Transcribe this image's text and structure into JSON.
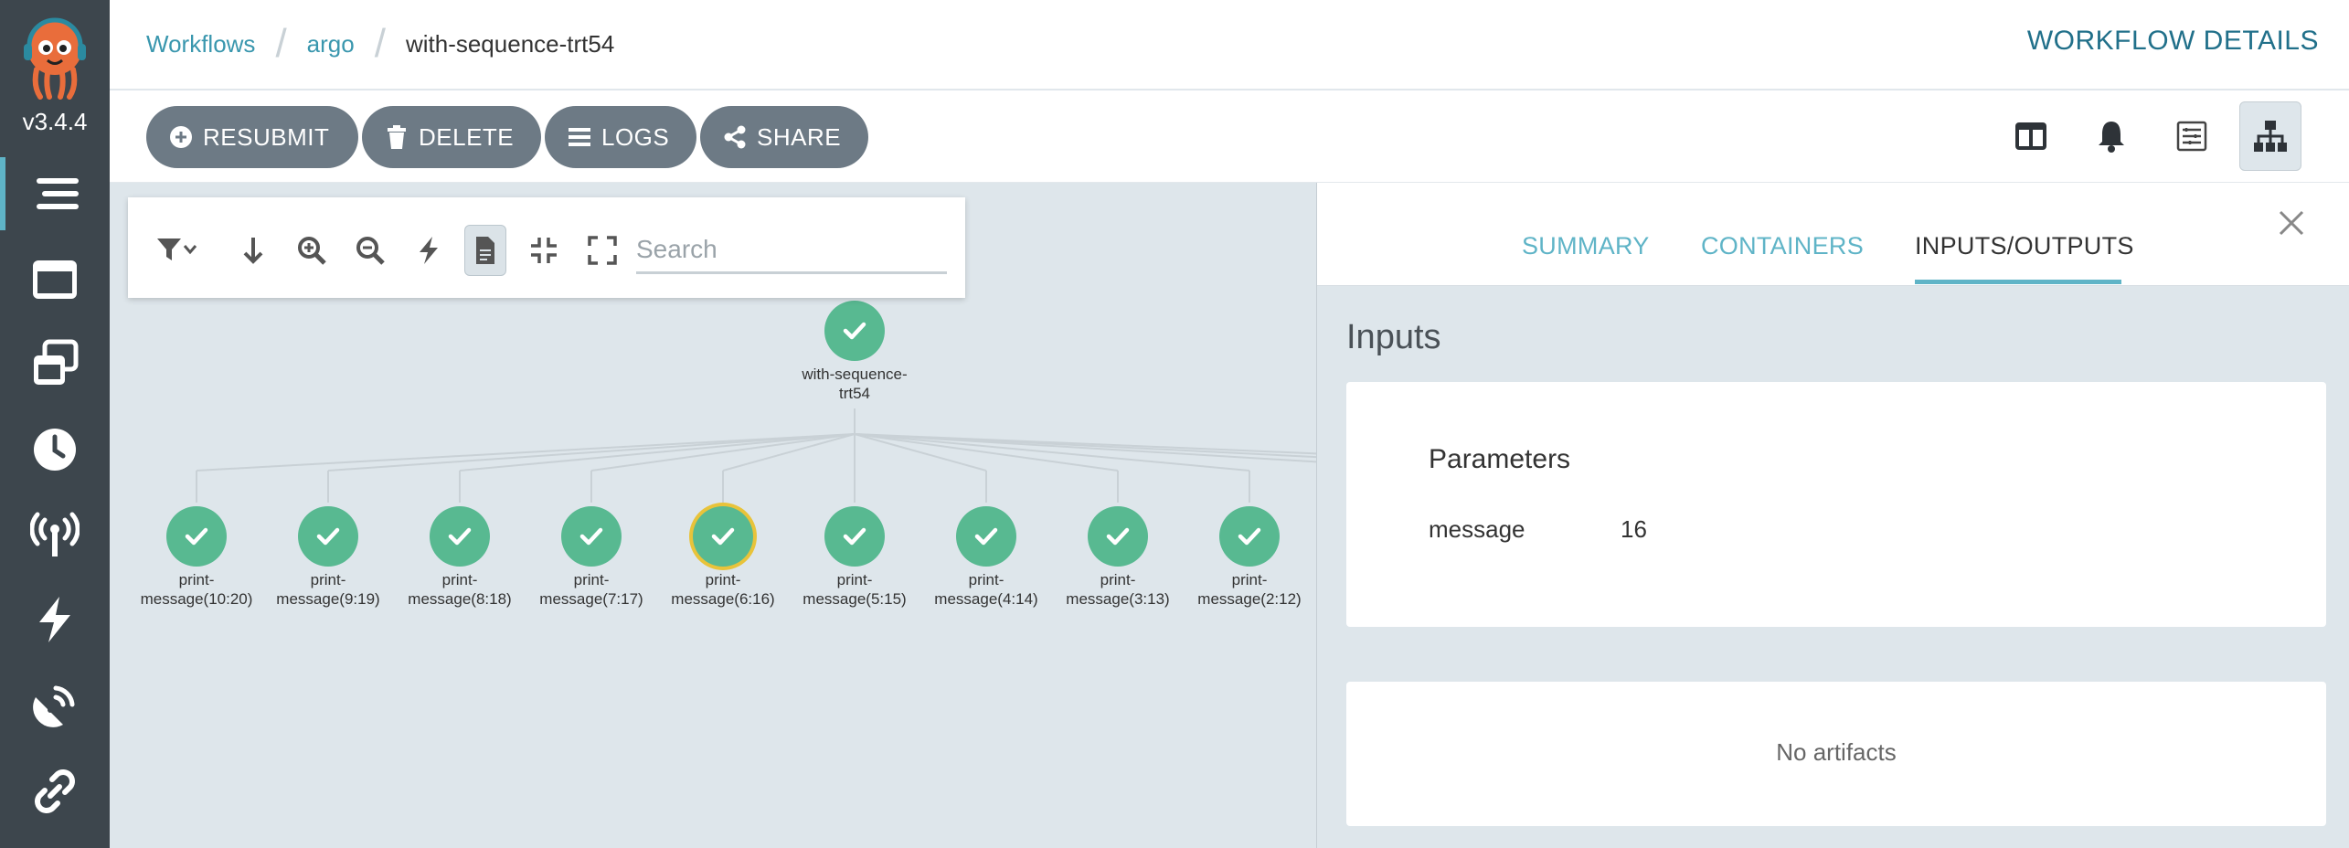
{
  "app": {
    "version": "v3.4.4",
    "accent": "#5fb4c7",
    "success": "#58b991",
    "selection": "#e8c33a"
  },
  "nav": {
    "items": [
      {
        "name": "workflows",
        "icon": "stream-icon"
      },
      {
        "name": "workflow-templates",
        "icon": "window-icon"
      },
      {
        "name": "cluster-workflow-templates",
        "icon": "window-stack-icon"
      },
      {
        "name": "cron-workflows",
        "icon": "clock-icon"
      },
      {
        "name": "event-sources",
        "icon": "broadcast-tower-icon"
      },
      {
        "name": "sensors",
        "icon": "bolt-icon"
      },
      {
        "name": "event-flow",
        "icon": "satellite-dish-icon"
      },
      {
        "name": "api-docs",
        "icon": "link-icon"
      }
    ]
  },
  "header": {
    "breadcrumbs": [
      "Workflows",
      "argo"
    ],
    "current": "with-sequence-trt54",
    "title": "WORKFLOW DETAILS"
  },
  "toolbar": {
    "buttons": [
      {
        "label": "RESUBMIT",
        "icon": "plus-circle-icon"
      },
      {
        "label": "DELETE",
        "icon": "trash-icon"
      },
      {
        "label": "LOGS",
        "icon": "bars-icon"
      },
      {
        "label": "SHARE",
        "icon": "share-icon"
      }
    ],
    "views": [
      {
        "name": "split-view",
        "icon": "columns-icon"
      },
      {
        "name": "events-view",
        "icon": "bell-icon"
      },
      {
        "name": "summary-view",
        "icon": "list-icon"
      },
      {
        "name": "graph-view",
        "icon": "sitemap-icon",
        "active": true
      }
    ]
  },
  "graph": {
    "search_placeholder": "Search",
    "controls": [
      "filter",
      "direction",
      "zoom-in",
      "zoom-out",
      "fast",
      "artifacts",
      "collapse",
      "fullscreen"
    ],
    "root": {
      "label_lines": [
        "with-sequence-",
        "trt54"
      ],
      "status": "succeeded"
    },
    "children": [
      {
        "label_lines": [
          "print-",
          "message(10:20)"
        ],
        "status": "succeeded"
      },
      {
        "label_lines": [
          "print-",
          "message(9:19)"
        ],
        "status": "succeeded"
      },
      {
        "label_lines": [
          "print-",
          "message(8:18)"
        ],
        "status": "succeeded"
      },
      {
        "label_lines": [
          "print-",
          "message(7:17)"
        ],
        "status": "succeeded"
      },
      {
        "label_lines": [
          "print-",
          "message(6:16)"
        ],
        "status": "succeeded",
        "selected": true
      },
      {
        "label_lines": [
          "print-",
          "message(5:15)"
        ],
        "status": "succeeded"
      },
      {
        "label_lines": [
          "print-",
          "message(4:14)"
        ],
        "status": "succeeded"
      },
      {
        "label_lines": [
          "print-",
          "message(3:13)"
        ],
        "status": "succeeded"
      },
      {
        "label_lines": [
          "print-",
          "message(2:12)"
        ],
        "status": "succeeded"
      }
    ]
  },
  "panel": {
    "tabs": [
      {
        "label": "SUMMARY",
        "active": false
      },
      {
        "label": "CONTAINERS",
        "active": false
      },
      {
        "label": "INPUTS/OUTPUTS",
        "active": true
      }
    ],
    "section_title": "Inputs",
    "parameters": {
      "title": "Parameters",
      "rows": [
        {
          "name": "message",
          "value": "16"
        }
      ]
    },
    "artifacts_empty": "No artifacts"
  }
}
